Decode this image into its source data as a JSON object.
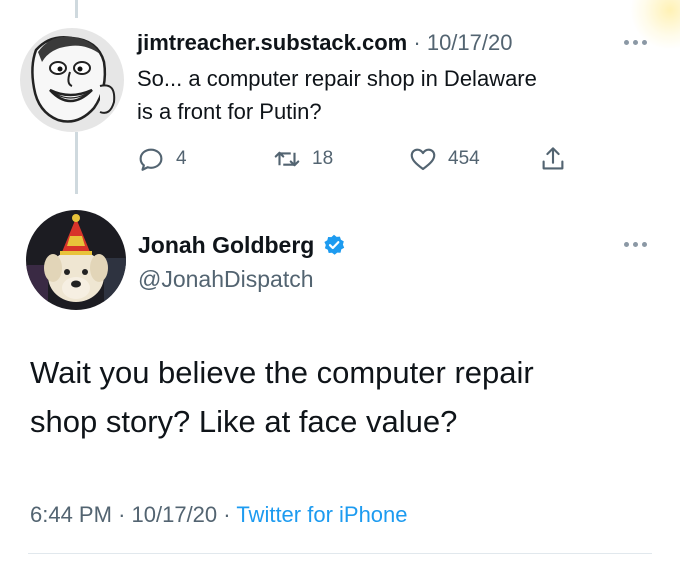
{
  "reply_tweet": {
    "display_name": "jimtreacher.substack.com",
    "separator": "·",
    "date": "10/17/20",
    "text_line1": "So... a computer repair shop in Delaware",
    "text_line2": "is a front for Putin?",
    "actions": {
      "reply_count": "4",
      "retweet_count": "18",
      "like_count": "454"
    }
  },
  "main_tweet": {
    "display_name": "Jonah Goldberg",
    "handle": "@JonahDispatch",
    "text_line1": "Wait you believe the computer repair",
    "text_line2": "shop story? Like at face value?",
    "time": "6:44 PM",
    "dot1": "·",
    "date": "10/17/20",
    "dot2": "·",
    "source": "Twitter for iPhone"
  },
  "colors": {
    "link_blue": "#1d9bf0",
    "muted_gray": "#536471",
    "text_dark": "#0f1419",
    "verified_blue": "#1d9bf0"
  },
  "icons": [
    "more-icon",
    "reply-icon",
    "retweet-icon",
    "like-icon",
    "share-icon",
    "verified-badge-icon"
  ]
}
